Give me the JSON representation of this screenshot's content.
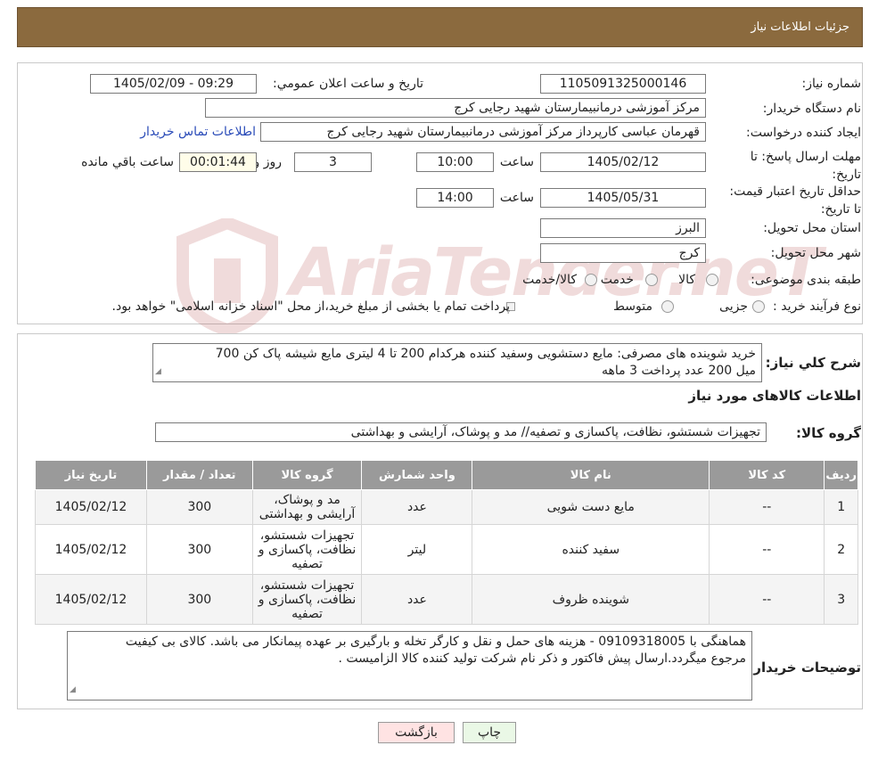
{
  "header": {
    "title": "جزئیات اطلاعات نیاز"
  },
  "form": {
    "need_number": {
      "label": "شماره نیاز:",
      "value": "1105091325000146"
    },
    "announce_datetime": {
      "label": "تاریخ و ساعت اعلان عمومي:",
      "value": "1405/02/09 - 09:29"
    },
    "buyer_org": {
      "label": "نام دستگاه خريدار:",
      "value": "مرکز آموزشی درمانبیمارستان شهید رجایی کرج"
    },
    "requester": {
      "label": "ايجاد کننده درخواست:",
      "value": "قهرمان عباسی کارپرداز مرکز آموزشی درمانبیمارستان شهید رجایی کرج",
      "contact_link": "اطلاعات تماس خریدار"
    },
    "deadline": {
      "label": "مهلت ارسال پاسخ: تا تاريخ:",
      "date": "1405/02/12",
      "time_label": "ساعت",
      "time": "10:00",
      "days": "3",
      "days_label": "روز و",
      "remaining": "00:01:44",
      "remaining_label": "ساعت باقي مانده"
    },
    "price_validity": {
      "label": "حداقل تاريخ اعتبار قيمت: تا تاريخ:",
      "date": "1405/05/31",
      "time_label": "ساعت",
      "time": "14:00"
    },
    "province": {
      "label": "استان محل تحويل:",
      "value": "البرز"
    },
    "city": {
      "label": "شهر محل تحويل:",
      "value": "کرج"
    },
    "category": {
      "label": "طبقه بندی موضوعی:",
      "options": [
        "کالا",
        "خدمت",
        "کالا/خدمت"
      ],
      "selected": "کالا"
    },
    "purchase_type": {
      "label": "نوع فرآیند خرید :",
      "options": [
        "جزیی",
        "متوسط"
      ],
      "note": "پرداخت تمام یا بخشی از مبلغ خرید،از محل \"اسناد خزانه اسلامی\" خواهد بود."
    }
  },
  "watermark": {
    "text": "AriaTender.neT"
  },
  "description": {
    "label": "شرح کلي نياز:",
    "line1": "خرید شوینده های مصرفی: مایع دستشویی وسفید کننده هرکدام  200 تا 4 لیتری مایع  شیشه پاک کن  700",
    "line2": "میل  200 عدد   پرداخت  3 ماهه"
  },
  "goods_section": {
    "title": "اطلاعات کالاهای مورد نیاز",
    "group_label": "گروه کالا:",
    "group_value": "تجهیزات شستشو، نظافت، پاکسازی و تصفیه// مد و پوشاک، آرایشی و بهداشتی"
  },
  "table": {
    "headers": [
      "رديف",
      "کد کالا",
      "نام کالا",
      "واحد شمارش",
      "گروه کالا",
      "تعداد / مقدار",
      "تاریخ نیاز"
    ],
    "rows": [
      {
        "index": "1",
        "code": "--",
        "name": "مایع دست شویی",
        "unit": "عدد",
        "group": "مد و پوشاک، آرایشی و بهداشتی",
        "qty": "300",
        "date": "1405/02/12"
      },
      {
        "index": "2",
        "code": "--",
        "name": "سفید کننده",
        "unit": "لیتر",
        "group": "تجهیزات شستشو، نظافت، پاکسازی و تصفیه",
        "qty": "300",
        "date": "1405/02/12"
      },
      {
        "index": "3",
        "code": "--",
        "name": "شوینده ظروف",
        "unit": "عدد",
        "group": "تجهیزات شستشو، نظافت، پاکسازی و تصفیه",
        "qty": "300",
        "date": "1405/02/12"
      }
    ]
  },
  "buyer_notes": {
    "label": "توضيحات خريدار:",
    "line1": "هماهنگی با 09109318005 - هزینه های  حمل و نقل و کارگر تخله و بارگیری بر عهده پیمانکار می باشد. کالای بی کیفیت",
    "line2": "مرجوع میگردد.ارسال پیش فاکتور و ذکر نام شرکت تولید کننده کالا الزامیست ."
  },
  "buttons": {
    "print": "چاپ",
    "back": "بازگشت"
  }
}
